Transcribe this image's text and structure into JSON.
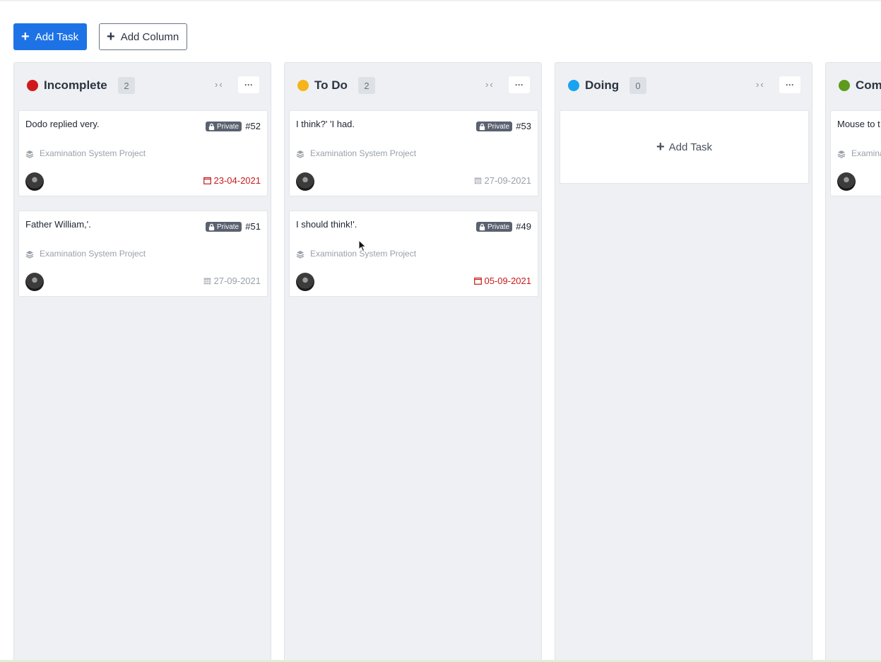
{
  "toolbar": {
    "add_task_label": "Add Task",
    "add_column_label": "Add Column"
  },
  "columns": [
    {
      "title": "Incomplete",
      "count": "2",
      "color": "#d0191c",
      "collapse_label": "›‹",
      "menu_label": "···",
      "cards": [
        {
          "title": "Dodo replied very.",
          "badge": "Private",
          "number": "#52",
          "project": "Examination System Project",
          "due": "23-04-2021",
          "due_status": "overdue"
        },
        {
          "title": "Father William,'.",
          "badge": "Private",
          "number": "#51",
          "project": "Examination System Project",
          "due": "27-09-2021",
          "due_status": "normal"
        }
      ]
    },
    {
      "title": "To Do",
      "count": "2",
      "color": "#f5b41a",
      "collapse_label": "›‹",
      "menu_label": "···",
      "cards": [
        {
          "title": "I think?' 'I had.",
          "badge": "Private",
          "number": "#53",
          "project": "Examination System Project",
          "due": "27-09-2021",
          "due_status": "normal"
        },
        {
          "title": "I should think!'.",
          "badge": "Private",
          "number": "#49",
          "project": "Examination System Project",
          "due": "05-09-2021",
          "due_status": "overdue"
        }
      ]
    },
    {
      "title": "Doing",
      "count": "0",
      "color": "#1aa3f0",
      "collapse_label": "›‹",
      "menu_label": "···",
      "add_task_label": "Add Task"
    },
    {
      "title": "Com",
      "color": "#5e9a1e",
      "cards": [
        {
          "title": "Mouse to t",
          "project": "Examina"
        }
      ]
    }
  ]
}
